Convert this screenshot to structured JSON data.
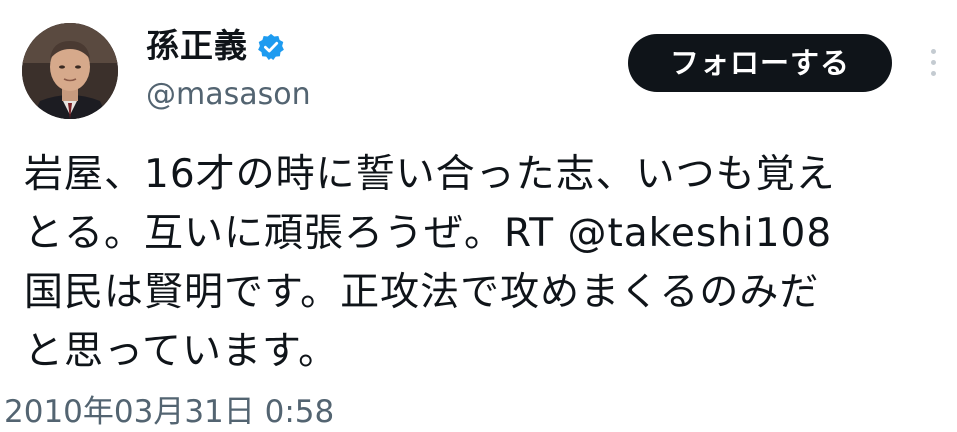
{
  "author": {
    "display_name": "孫正義",
    "handle": "@masason",
    "verified_icon": "verified-badge-icon",
    "verified_color": "#1d9bf0"
  },
  "actions": {
    "follow_label": "フォローする",
    "more_icon": "more-vertical-icon"
  },
  "tweet": {
    "text": "岩屋、16才の時に誓い合った志、いつも覚え\nとる。互いに頑張ろうぜ。RT @takeshi108\n国民は賢明です。正攻法で攻めまくるのみだ\nと思っています。",
    "timestamp": "2010年03月31日 0:58"
  },
  "colors": {
    "text_primary": "#0f1419",
    "text_secondary": "#536471",
    "button_bg": "#0f1419",
    "button_text": "#ffffff"
  }
}
